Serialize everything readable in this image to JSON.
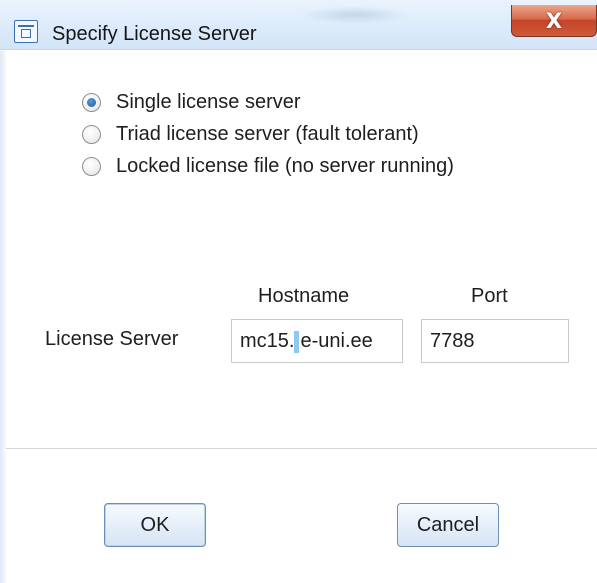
{
  "window": {
    "title": "Specify License Server",
    "close_glyph": "X",
    "icon": "window-app-icon",
    "close_color": "#d9694a"
  },
  "server_type": {
    "options": [
      {
        "label": "Single license server",
        "selected": true
      },
      {
        "label": "Triad license server (fault tolerant)",
        "selected": false
      },
      {
        "label": "Locked license file (no server running)",
        "selected": false
      }
    ]
  },
  "license_server": {
    "row_label": "License Server",
    "hostname_header": "Hostname",
    "port_header": "Port",
    "hostname_value_before_caret": "mc15.",
    "hostname_value_after_caret": "e-uni.ee",
    "port_value": "7788"
  },
  "buttons": {
    "ok_label": "OK",
    "cancel_label": "Cancel"
  },
  "colors": {
    "accent": "#1e5aa0",
    "title_bar": "#dcebfb"
  }
}
